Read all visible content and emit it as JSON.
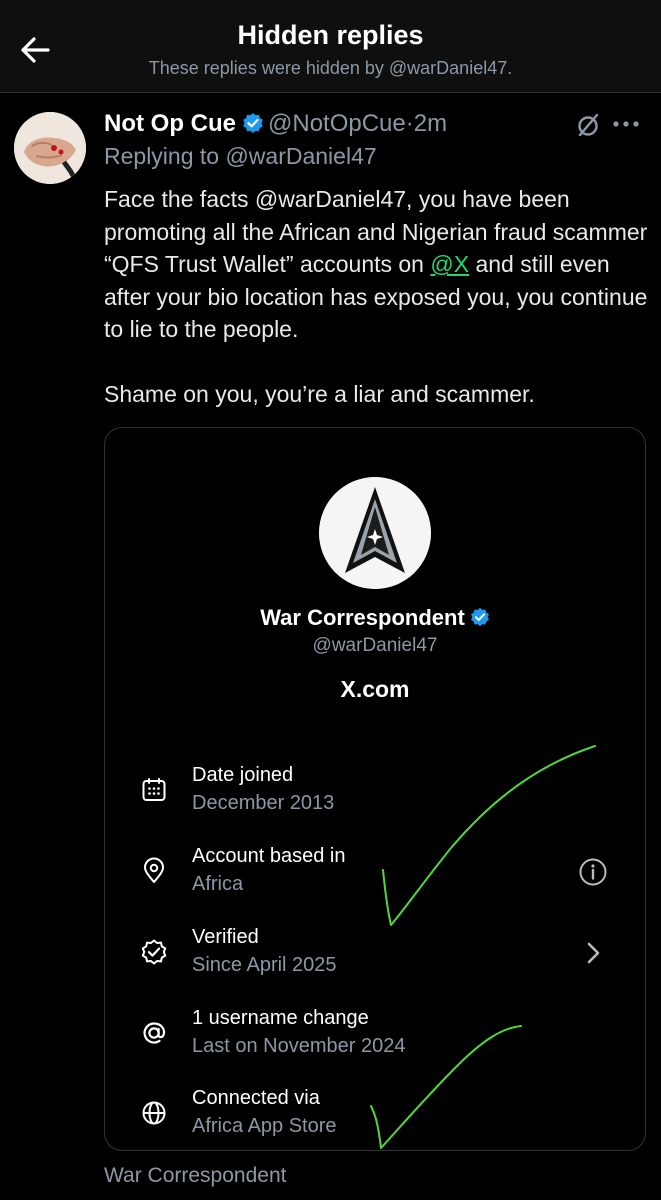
{
  "header": {
    "title": "Hidden replies",
    "subtitle": "These replies were hidden by @warDaniel47."
  },
  "tweet": {
    "author_name": "Not Op Cue",
    "handle": "@NotOpCue",
    "separator": "·",
    "time": "2m",
    "replying_to": "Replying to @warDaniel47",
    "text": {
      "part1": "Face the facts @warDaniel47, you have been promoting all the African and Nigerian fraud scammer “QFS Trust Wallet” accounts on ",
      "mention": "@X",
      "part2": " and still even after your bio location has exposed you, you continue to lie to the people.",
      "paragraph2": "Shame on you, you’re a liar and scammer."
    }
  },
  "card": {
    "name": "War Correspondent",
    "handle": "@warDaniel47",
    "domain": "X.com",
    "rows": [
      {
        "label": "Date joined",
        "value": "December 2013",
        "icon": "calendar-icon"
      },
      {
        "label": "Account based in",
        "value": "Africa",
        "icon": "location-pin-icon"
      },
      {
        "label": "Verified",
        "value": "Since April 2025",
        "icon": "verified-check-icon"
      },
      {
        "label": "1 username change",
        "value": "Last on November 2024",
        "icon": "at-sign-icon"
      },
      {
        "label": "Connected via",
        "value": "Africa App Store",
        "icon": "globe-icon"
      }
    ],
    "footer": "War Correspondent"
  },
  "colors": {
    "background": "#000000",
    "text": "#e7e9ea",
    "muted": "#8b98a5",
    "verified_blue": "#1d9bf0",
    "link_green": "#24d672",
    "scribble_green": "#53d63a"
  }
}
